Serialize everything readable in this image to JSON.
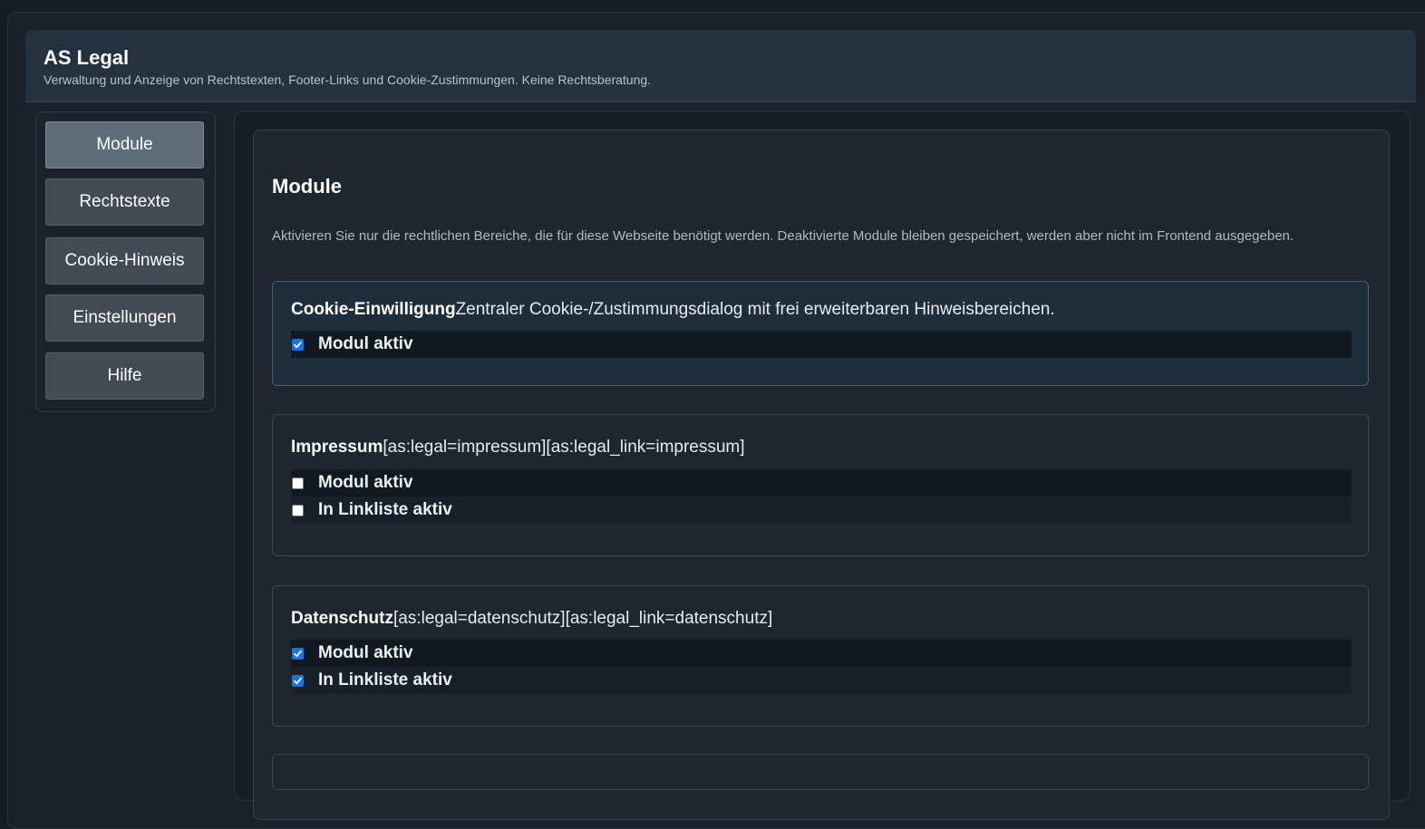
{
  "header": {
    "title": "AS Legal",
    "subtitle": "Verwaltung und Anzeige von Rechtstexten, Footer-Links und Cookie-Zustimmungen. Keine Rechtsberatung."
  },
  "sidebar": {
    "items": [
      {
        "label": "Module",
        "active": true
      },
      {
        "label": "Rechtstexte",
        "active": false
      },
      {
        "label": "Cookie-Hinweis",
        "active": false
      },
      {
        "label": "Einstellungen",
        "active": false
      },
      {
        "label": "Hilfe",
        "active": false
      }
    ]
  },
  "main": {
    "title": "Module",
    "description": "Aktivieren Sie nur die rechtlichen Bereiche, die für diese Webseite benötigt werden. Deaktivierte Module bleiben gespeichert, werden aber nicht im Frontend ausgegeben.",
    "modules": [
      {
        "name": "Cookie-Einwilligung",
        "info": "Zentraler Cookie-/Zustimmungsdialog mit frei erweiterbaren Hinweisbereichen.",
        "options": [
          {
            "label": "Modul aktiv",
            "checked": true
          }
        ]
      },
      {
        "name": "Impressum",
        "info": "[as:legal=impressum][as:legal_link=impressum]",
        "options": [
          {
            "label": "Modul aktiv",
            "checked": false
          },
          {
            "label": "In Linkliste aktiv",
            "checked": false
          }
        ]
      },
      {
        "name": "Datenschutz",
        "info": "[as:legal=datenschutz][as:legal_link=datenschutz]",
        "options": [
          {
            "label": "Modul aktiv",
            "checked": true
          },
          {
            "label": "In Linkliste aktiv",
            "checked": true
          }
        ]
      }
    ]
  },
  "colors": {
    "accent": "#1a73e8",
    "background": "#161c24",
    "header_bg": "#243140"
  }
}
